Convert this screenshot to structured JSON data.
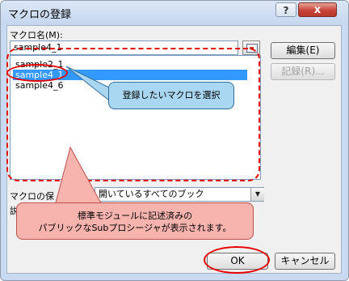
{
  "window": {
    "title": "マクロの登録",
    "help_label": "?",
    "close_label": "x"
  },
  "macro_name": {
    "label": "マクロ名(M):",
    "value": "sample4_1"
  },
  "macro_list": [
    {
      "label": "sample2_1",
      "selected": false
    },
    {
      "label": "sample4_1",
      "selected": true
    },
    {
      "label": "sample4_6",
      "selected": false
    }
  ],
  "location": {
    "label": "マクロの保",
    "value": "開いているすべてのブック"
  },
  "description_label": "説",
  "buttons": {
    "edit": "編集(E)",
    "record": "記録(R)...",
    "ok": "OK",
    "cancel": "キャンセル"
  },
  "callouts": {
    "select_macro": "登録したいマクロを選択",
    "note_line1": "標準モジュールに記述済みの",
    "note_line2": "パブリックなSubプロシージャが表示されます。"
  },
  "colors": {
    "annotation_red": "#e60000",
    "selection_blue": "#3399ff",
    "callout_blue": "#a9d6f0",
    "callout_pink": "#f7b3ad"
  }
}
